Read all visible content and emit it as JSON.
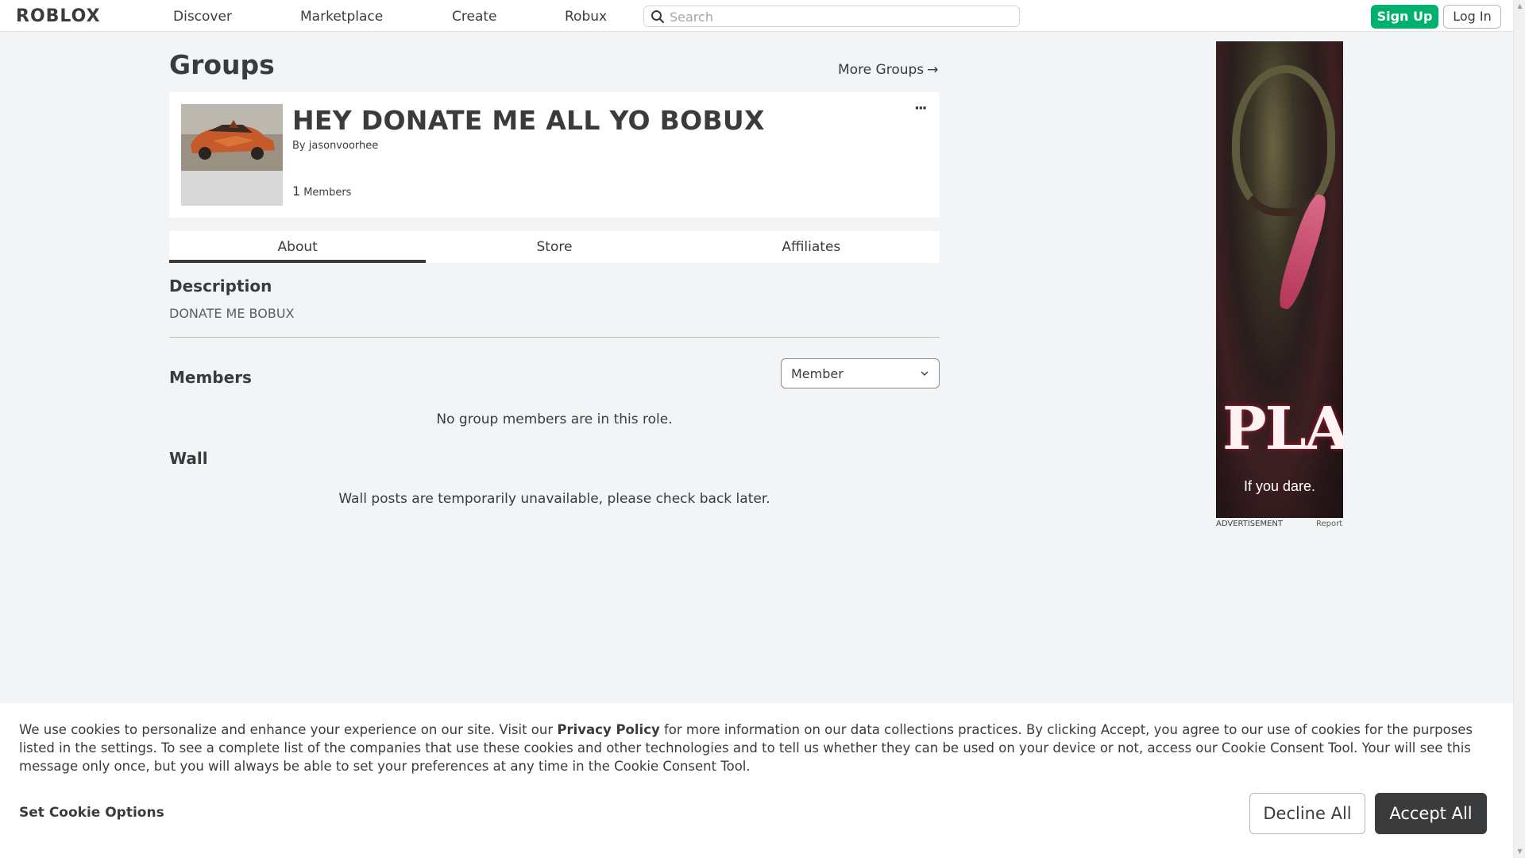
{
  "nav": {
    "logo": "ROBLOX",
    "links": [
      "Discover",
      "Marketplace",
      "Create",
      "Robux"
    ],
    "search_placeholder": "Search",
    "signup_label": "Sign Up",
    "login_label": "Log In"
  },
  "page": {
    "title": "Groups",
    "more_groups": "More Groups",
    "more_groups_arrow": "→"
  },
  "group": {
    "name": "HEY DONATE ME ALL YO BOBUX",
    "by_label": "By",
    "owner": "jasonvoorhee",
    "member_count": "1",
    "members_label": "Members",
    "more_menu": "···"
  },
  "tabs": [
    "About",
    "Store",
    "Affiliates"
  ],
  "about": {
    "description_heading": "Description",
    "description_text": "DONATE ME BOBUX",
    "members_heading": "Members",
    "role_selected": "Member",
    "members_empty": "No group members are in this role.",
    "wall_heading": "Wall",
    "wall_empty": "Wall posts are temporarily unavailable, please check back later."
  },
  "ad": {
    "headline": "PLAY",
    "tagline": "If you dare.",
    "label": "ADVERTISEMENT",
    "report": "Report"
  },
  "cookie": {
    "text_before": "We use cookies to personalize and enhance your experience on our site. Visit our ",
    "privacy_link": "Privacy Policy",
    "text_after": " for more information on our data collections practices. By clicking Accept, you agree to our use of cookies for the purposes listed in the settings. To see a complete list of the companies that use these cookies and other technologies and to tell us whether they can be used on your device or not, access our Cookie Consent Tool. Your will see this message only once, but you will always be able to set your preferences at any time in the Cookie Consent Tool.",
    "options_label": "Set Cookie Options",
    "decline_label": "Decline All",
    "accept_label": "Accept All"
  },
  "colors": {
    "signup_green": "#00b06f",
    "page_bg": "#f2f4f5",
    "text_dark": "#393b3d",
    "accept_bg": "#393b3d"
  },
  "icons": [
    "search-icon",
    "chevron-down-icon",
    "arrow-right-icon",
    "more-dots-icon"
  ]
}
